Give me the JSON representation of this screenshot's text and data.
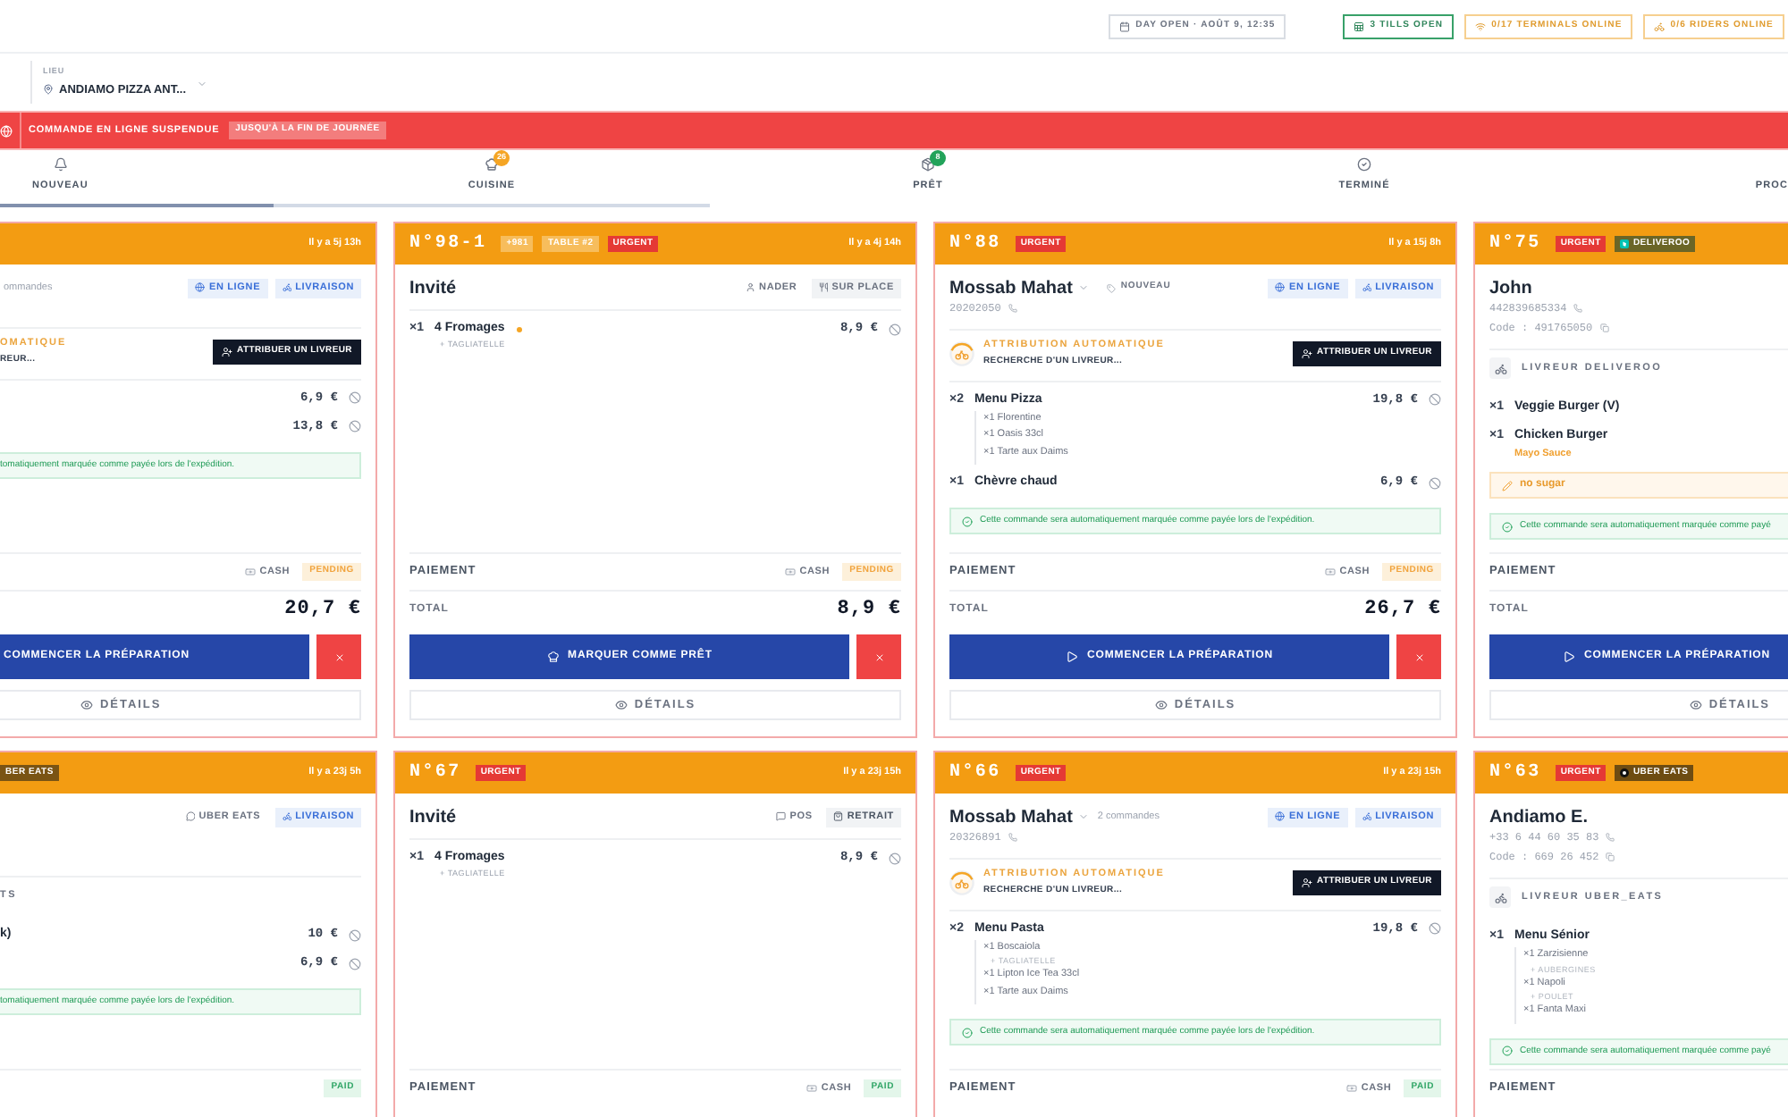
{
  "status_chips": [
    {
      "kind": "day",
      "label": "DAY OPEN · AOÛT 9, 12:35"
    },
    {
      "kind": "tills",
      "label": "3 TILLS OPEN"
    },
    {
      "kind": "terminals",
      "label": "0/17 TERMINALS ONLINE"
    },
    {
      "kind": "riders",
      "label": "0/6 RIDERS ONLINE"
    }
  ],
  "location": {
    "label": "LIEU",
    "value": "ANDIAMO PIZZA ANT..."
  },
  "banner": {
    "message": "COMMANDE EN LIGNE SUSPENDUE",
    "duration": "JUSQU'À LA FIN DE JOURNÉE"
  },
  "tabs": [
    {
      "kind": "new",
      "label": "NOUVEAU",
      "selected": true,
      "hovered": false
    },
    {
      "kind": "kitchen",
      "label": "CUISINE",
      "selected": false,
      "hovered": true,
      "badge": {
        "count": "26",
        "color": "#f5a524"
      }
    },
    {
      "kind": "ready",
      "label": "PRÊT",
      "selected": false,
      "hovered": false,
      "badge": {
        "count": "8",
        "color": "#22a35a"
      }
    },
    {
      "kind": "done",
      "label": "TERMINÉ",
      "selected": false,
      "hovered": false
    },
    {
      "kind": "other",
      "label": "PROC",
      "selected": false,
      "hovered": false
    }
  ],
  "orders": [
    {
      "time": "Il y a 5j 13h",
      "customer": {
        "meta": "ommandes"
      },
      "channels": [
        {
          "kind": "online",
          "label": "EN LIGNE"
        },
        {
          "kind": "delivery",
          "label": "LIVRAISON"
        }
      ],
      "dispatch": {
        "title": "OMATIQUE",
        "status": "REUR...",
        "button": "ATTRIBUER UN LIVREUR"
      },
      "items": [
        {
          "marked": false,
          "price": "6,9 €"
        },
        {
          "marked": false,
          "price": "13,8 €"
        }
      ],
      "notice": "tomatiquement marquée comme payée lors de l'expédition.",
      "payment": {
        "method": "CASH",
        "status": {
          "kind": "pending",
          "label": "PENDING"
        }
      },
      "total": {
        "amount": "20,7 €"
      },
      "action": {
        "kind": "prepare",
        "label": "COMMENCER LA PRÉPARATION"
      },
      "details": "DÉTAILS"
    },
    {
      "number": "N°98-1",
      "badges": [
        {
          "kind": "plain",
          "label": "+981",
          "color": "#f7bd5c"
        },
        {
          "kind": "plain",
          "label": "TABLE #2",
          "color": "#f7bd5c"
        },
        {
          "kind": "plain",
          "label": "URGENT",
          "color": "#e53935"
        }
      ],
      "time": "Il y a 4j 14h",
      "customer": {
        "name": "Invité",
        "expandable": false
      },
      "channels": [
        {
          "kind": "staff",
          "label": "NADER"
        },
        {
          "kind": "dinein",
          "label": "SUR PLACE"
        }
      ],
      "items": [
        {
          "qty": "×1",
          "name": "4 Fromages",
          "marked": true,
          "price": "8,9 €",
          "options": [
            "+ TAGLIATELLE"
          ]
        }
      ],
      "payment": {
        "label": "PAIEMENT",
        "method": "CASH",
        "status": {
          "kind": "pending",
          "label": "PENDING"
        }
      },
      "total": {
        "label": "TOTAL",
        "amount": "8,9 €"
      },
      "action": {
        "kind": "ready",
        "label": "MARQUER COMME PRÊT"
      },
      "details": "DÉTAILS"
    },
    {
      "number": "N°88",
      "badges": [
        {
          "kind": "plain",
          "label": "URGENT",
          "color": "#e53935"
        }
      ],
      "time": "Il y a 15j 8h",
      "customer": {
        "name": "Mossab Mahat",
        "expandable": true,
        "tag": "NOUVEAU",
        "phone": "20202050"
      },
      "channels": [
        {
          "kind": "online",
          "label": "EN LIGNE"
        },
        {
          "kind": "delivery",
          "label": "LIVRAISON"
        }
      ],
      "dispatch": {
        "title": "ATTRIBUTION AUTOMATIQUE",
        "status": "RECHERCHE D'UN LIVREUR...",
        "button": "ATTRIBUER UN LIVREUR"
      },
      "items": [
        {
          "qty": "×2",
          "name": "Menu Pizza",
          "marked": false,
          "price": "19,8 €",
          "children": [
            {
              "label": "×1 Florentine"
            },
            {
              "label": "×1 Oasis 33cl"
            },
            {
              "label": "×1 Tarte aux Daims"
            }
          ]
        },
        {
          "qty": "×1",
          "name": "Chèvre chaud",
          "marked": false,
          "price": "6,9 €"
        }
      ],
      "notice": "Cette commande sera automatiquement marquée comme payée lors de l'expédition.",
      "payment": {
        "label": "PAIEMENT",
        "method": "CASH",
        "status": {
          "kind": "pending",
          "label": "PENDING"
        }
      },
      "total": {
        "label": "TOTAL",
        "amount": "26,7 €"
      },
      "action": {
        "kind": "prepare",
        "label": "COMMENCER LA PRÉPARATION"
      },
      "details": "DÉTAILS"
    },
    {
      "number": "N°75",
      "badges": [
        {
          "kind": "plain",
          "label": "URGENT",
          "color": "#e53935"
        },
        {
          "kind": "tile",
          "label": "DELIVEROO",
          "color": "#6b6526"
        }
      ],
      "customer": {
        "name": "John",
        "expandable": false,
        "phone": "442839685334",
        "code": "Code : 491765050"
      },
      "rider": "LIVREUR DELIVEROO",
      "items": [
        {
          "qty": "×1",
          "name": "Veggie Burger (V)",
          "marked": false
        },
        {
          "qty": "×1",
          "name": "Chicken Burger",
          "marked": false,
          "comment": "Mayo Sauce"
        }
      ],
      "note": "no sugar",
      "notice": "Cette commande sera automatiquement marquée comme payé",
      "payment": {
        "label": "PAIEMENT"
      },
      "total": {
        "label": "TOTAL"
      },
      "action": {
        "kind": "prepare",
        "label": "COMMENCER LA PRÉPARATION"
      },
      "details": "DÉTAILS"
    },
    {
      "badges": [
        {
          "kind": "plain",
          "label": "BER EATS",
          "color": "#7a5414"
        }
      ],
      "time": "Il y a 23j 5h",
      "channels": [
        {
          "kind": "platform",
          "label": "UBER EATS"
        },
        {
          "kind": "delivery",
          "label": "LIVRAISON"
        }
      ],
      "rider": "TS",
      "items": [
        {
          "name": "k)",
          "marked": false,
          "price": "10 €"
        },
        {
          "marked": false,
          "price": "6,9 €"
        }
      ],
      "notice": "tomatiquement marquée comme payée lors de l'expédition.",
      "payment": {
        "status": {
          "kind": "paid",
          "label": "PAID"
        }
      }
    },
    {
      "number": "N°67",
      "badges": [
        {
          "kind": "plain",
          "label": "URGENT",
          "color": "#e53935"
        }
      ],
      "time": "Il y a 23j 15h",
      "customer": {
        "name": "Invité",
        "expandable": false
      },
      "channels": [
        {
          "kind": "pos",
          "label": "POS"
        },
        {
          "kind": "pickup",
          "label": "RETRAIT"
        }
      ],
      "items": [
        {
          "qty": "×1",
          "name": "4 Fromages",
          "marked": false,
          "price": "8,9 €",
          "options": [
            "+ TAGLIATELLE"
          ]
        }
      ],
      "payment": {
        "label": "PAIEMENT",
        "method": "CASH",
        "status": {
          "kind": "paid",
          "label": "PAID"
        }
      }
    },
    {
      "number": "N°66",
      "badges": [
        {
          "kind": "plain",
          "label": "URGENT",
          "color": "#e53935"
        }
      ],
      "time": "Il y a 23j 15h",
      "customer": {
        "name": "Mossab Mahat",
        "expandable": true,
        "meta": "2 commandes",
        "phone": "20326891"
      },
      "channels": [
        {
          "kind": "online",
          "label": "EN LIGNE"
        },
        {
          "kind": "delivery",
          "label": "LIVRAISON"
        }
      ],
      "dispatch": {
        "title": "ATTRIBUTION AUTOMATIQUE",
        "status": "RECHERCHE D'UN LIVREUR...",
        "button": "ATTRIBUER UN LIVREUR"
      },
      "items": [
        {
          "qty": "×2",
          "name": "Menu Pasta",
          "marked": false,
          "price": "19,8 €",
          "children": [
            {
              "label": "×1 Boscaiola",
              "options": [
                "+ TAGLIATELLE"
              ]
            },
            {
              "label": "×1 Lipton Ice Tea 33cl"
            },
            {
              "label": "×1 Tarte aux Daims"
            }
          ]
        }
      ],
      "notice": "Cette commande sera automatiquement marquée comme payée lors de l'expédition.",
      "payment": {
        "label": "PAIEMENT",
        "method": "CASH",
        "status": {
          "kind": "paid",
          "label": "PAID"
        }
      }
    },
    {
      "number": "N°63",
      "badges": [
        {
          "kind": "plain",
          "label": "URGENT",
          "color": "#e53935"
        },
        {
          "kind": "disc",
          "label": "UBER EATS",
          "color": "#6e4c12"
        }
      ],
      "customer": {
        "name": "Andiamo E.",
        "expandable": false,
        "phone": "+33 6 44 60 35 83",
        "code": "Code : 669 26 452"
      },
      "rider": "LIVREUR UBER_EATS",
      "items": [
        {
          "qty": "×1",
          "name": "Menu Sénior",
          "marked": false,
          "children": [
            {
              "label": "×1 Zarzisienne",
              "options": [
                "+ AUBERGINES"
              ]
            },
            {
              "label": "×1 Napoli",
              "options": [
                "+ POULET"
              ]
            },
            {
              "label": "×1 Fanta Maxi"
            }
          ]
        }
      ],
      "notice": "Cette commande sera automatiquement marquée comme payé",
      "payment": {
        "label": "PAIEMENT"
      }
    }
  ]
}
